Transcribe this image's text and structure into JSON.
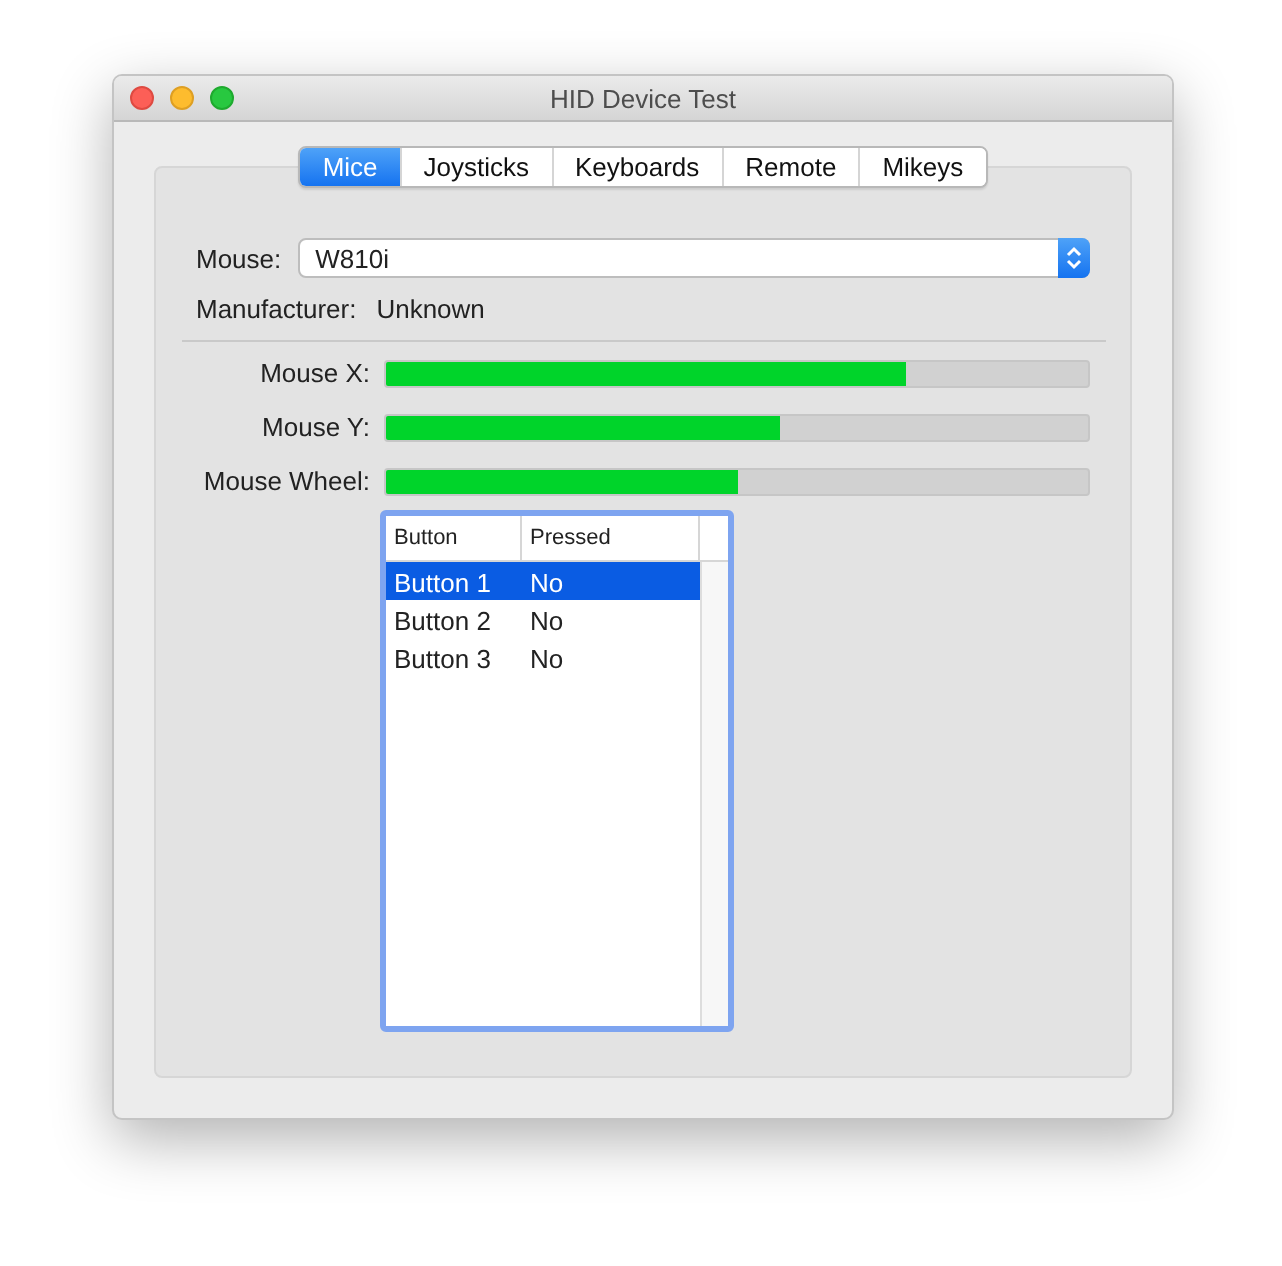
{
  "window": {
    "title": "HID Device Test"
  },
  "tabs": [
    {
      "label": "Mice",
      "selected": true
    },
    {
      "label": "Joysticks",
      "selected": false
    },
    {
      "label": "Keyboards",
      "selected": false
    },
    {
      "label": "Remote",
      "selected": false
    },
    {
      "label": "Mikeys",
      "selected": false
    }
  ],
  "mouse": {
    "label": "Mouse:",
    "value": "W810i"
  },
  "manufacturer": {
    "label": "Manufacturer:",
    "value": "Unknown"
  },
  "meters": [
    {
      "label": "Mouse X:",
      "level": 0.74
    },
    {
      "label": "Mouse Y:",
      "level": 0.56
    },
    {
      "label": "Mouse Wheel:",
      "level": 0.5
    }
  ],
  "table": {
    "columns": [
      "Button",
      "Pressed"
    ],
    "rows": [
      {
        "cells": [
          "Button 1",
          "No"
        ],
        "selected": true
      },
      {
        "cells": [
          "Button 2",
          "No"
        ],
        "selected": false
      },
      {
        "cells": [
          "Button 3",
          "No"
        ],
        "selected": false
      }
    ]
  }
}
